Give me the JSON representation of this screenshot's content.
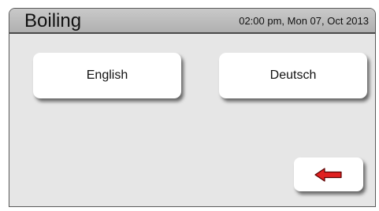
{
  "header": {
    "title": "Boiling",
    "datetime": "02:00 pm, Mon 07, Oct 2013"
  },
  "languages": {
    "english_label": "English",
    "deutsch_label": "Deutsch"
  },
  "navigation": {
    "back_icon": "left-arrow-icon",
    "back_icon_color": "#e02020"
  }
}
